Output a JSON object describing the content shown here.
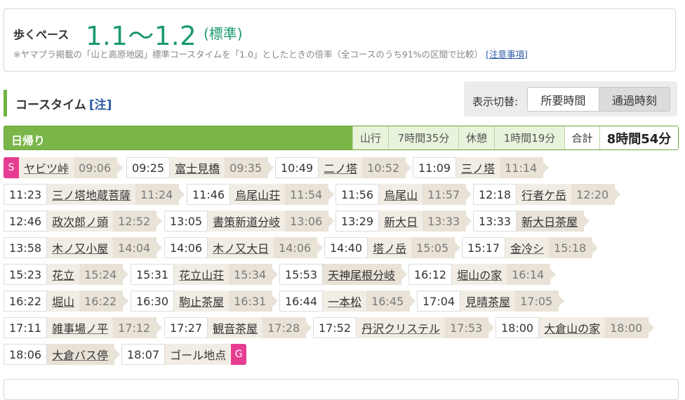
{
  "pace": {
    "label": "歩くペース",
    "value": "1.1〜1.2",
    "standard": "(標準)",
    "note": "※ヤマプラ掲載の「山と高原地図」標準コースタイムを「1.0」としたときの倍率（全コースのうち91%の区間で比較）",
    "note_link": "[注意事項]"
  },
  "course_time": {
    "title": "コースタイム",
    "note": "[注]"
  },
  "display_switch": {
    "label": "表示切替:",
    "options": [
      "所要時間",
      "通過時刻"
    ],
    "selected": "通過時刻"
  },
  "day_summary": {
    "label": "日帰り",
    "walk_label": "山行",
    "walk_time": "7時間35分",
    "rest_label": "休憩",
    "rest_time": "1時間19分",
    "total_label": "合計",
    "total_time": "8時間54分"
  },
  "markers": {
    "start": "S",
    "goal": "G"
  },
  "route": [
    {
      "arr": "",
      "name": "ヤビツ峠",
      "dep": "09:06"
    },
    {
      "arr": "09:25",
      "name": "富士見橋",
      "dep": "09:35"
    },
    {
      "arr": "10:49",
      "name": "二ノ塔",
      "dep": "10:52"
    },
    {
      "arr": "11:09",
      "name": "三ノ塔",
      "dep": "11:14"
    },
    {
      "arr": "11:23",
      "name": "三ノ塔地蔵菩薩",
      "dep": "11:24"
    },
    {
      "arr": "11:46",
      "name": "烏尾山荘",
      "dep": "11:54"
    },
    {
      "arr": "11:56",
      "name": "烏尾山",
      "dep": "11:57"
    },
    {
      "arr": "12:18",
      "name": "行者ケ岳",
      "dep": "12:20"
    },
    {
      "arr": "12:46",
      "name": "政次郎ノ頭",
      "dep": "12:52"
    },
    {
      "arr": "13:05",
      "name": "書策新道分岐",
      "dep": "13:06"
    },
    {
      "arr": "13:29",
      "name": "新大日",
      "dep": "13:33"
    },
    {
      "arr": "13:33",
      "name": "新大日茶屋",
      "dep": ""
    },
    {
      "arr": "13:58",
      "name": "木ノ又小屋",
      "dep": "14:04"
    },
    {
      "arr": "14:06",
      "name": "木ノ又大日",
      "dep": "14:06"
    },
    {
      "arr": "14:40",
      "name": "塔ノ岳",
      "dep": "15:05"
    },
    {
      "arr": "15:17",
      "name": "金冷シ",
      "dep": "15:18"
    },
    {
      "arr": "15:23",
      "name": "花立",
      "dep": "15:24"
    },
    {
      "arr": "15:31",
      "name": "花立山荘",
      "dep": "15:34"
    },
    {
      "arr": "15:53",
      "name": "天神尾根分岐",
      "dep": ""
    },
    {
      "arr": "16:12",
      "name": "堀山の家",
      "dep": "16:14"
    },
    {
      "arr": "16:22",
      "name": "堀山",
      "dep": "16:22"
    },
    {
      "arr": "16:30",
      "name": "駒止茶屋",
      "dep": "16:31"
    },
    {
      "arr": "16:44",
      "name": "一本松",
      "dep": "16:45"
    },
    {
      "arr": "17:04",
      "name": "見晴茶屋",
      "dep": "17:05"
    },
    {
      "arr": "17:11",
      "name": "雑事場ノ平",
      "dep": "17:12"
    },
    {
      "arr": "17:27",
      "name": "観音茶屋",
      "dep": "17:28"
    },
    {
      "arr": "17:52",
      "name": "丹沢クリステル",
      "dep": "17:53"
    },
    {
      "arr": "18:00",
      "name": "大倉山の家",
      "dep": "18:00"
    },
    {
      "arr": "18:06",
      "name": "大倉バス停",
      "dep": ""
    },
    {
      "arr": "18:07",
      "name": "ゴール地点",
      "dep": ""
    }
  ]
}
